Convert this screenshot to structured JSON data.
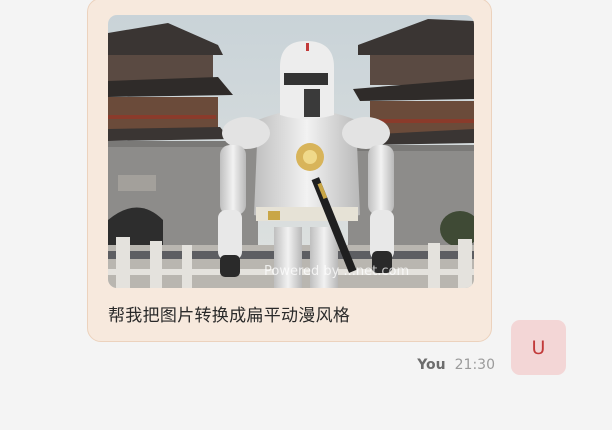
{
  "message": {
    "text": "帮我把图片转换成扁平动漫风格",
    "image": {
      "watermark": "Powered by ...net.com"
    }
  },
  "meta": {
    "sender": "You",
    "time": "21:30"
  },
  "avatar": {
    "initial": "U"
  },
  "colors": {
    "bubble_bg": "#f7e9dd",
    "bubble_border": "#ecd2bd",
    "avatar_bg": "#f3d6d6",
    "avatar_text": "#c23a3a"
  }
}
